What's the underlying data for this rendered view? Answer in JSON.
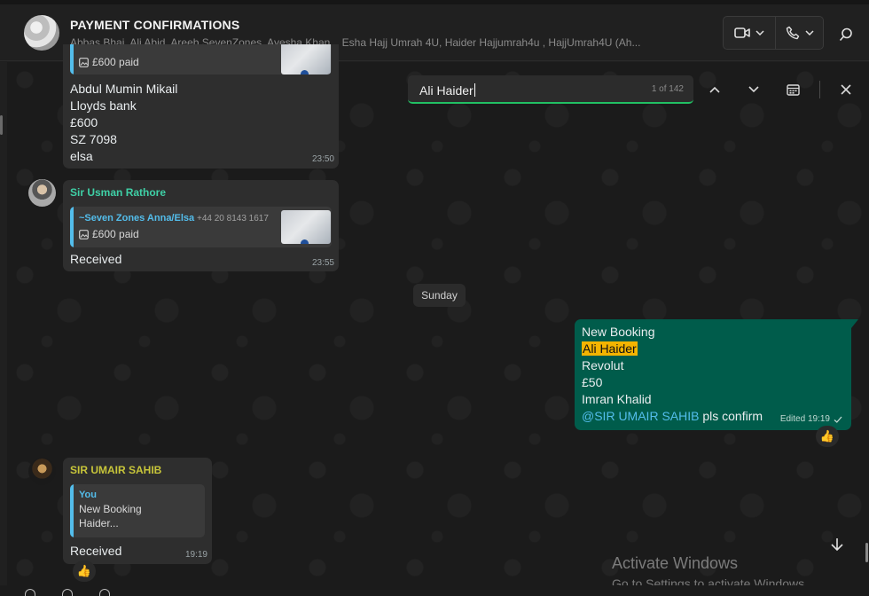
{
  "header": {
    "title": "PAYMENT CONFIRMATIONS",
    "members": "Abbas Bhai, Ali Abid, Areeb SevenZones, Ayesha Khan.., Esha Hajj Umrah 4U, Haider Hajjumrah4u , HajjUmrah4U (Ah..."
  },
  "search": {
    "value": "Ali Haider",
    "count": "1 of 142"
  },
  "messages": {
    "first": {
      "quote_text": "£600 paid",
      "lines": [
        "Abdul Mumin Mikail",
        "Lloyds bank",
        "£600",
        "SZ 7098",
        "elsa"
      ],
      "time": "23:50"
    },
    "usman": {
      "sender": "Sir Usman Rathore",
      "quote_name": "~Seven Zones Anna/Elsa",
      "quote_phone": "+44 20 8143 1617",
      "quote_text": "£600 paid",
      "text": "Received",
      "time": "23:55"
    },
    "day_divider": "Sunday",
    "outgoing": {
      "line1": "New Booking",
      "highlight": "Ali Haider",
      "line3": "Revolut",
      "line4": "£50",
      "line5": "Imran Khalid",
      "mention": "@SIR UMAIR SAHIB",
      "suffix": " pls confirm",
      "status": "Edited 19:19",
      "reaction": "👍"
    },
    "umair": {
      "sender": "SIR UMAIR SAHIB",
      "quote_name": "You",
      "quote_line1": "New Booking",
      "quote_line2": "Haider...",
      "text": "Received",
      "time": "19:19",
      "reaction": "👍"
    }
  },
  "watermark": {
    "title": "Activate Windows",
    "subtitle": "Go to Settings to activate Windows."
  },
  "colors": {
    "accent_green": "#21c063",
    "outgoing_bubble": "#005c4b",
    "incoming_bubble": "#2e2e2e",
    "usman_name": "#3fd0a6",
    "umair_name": "#c7c53a",
    "highlight": "#f4b400"
  }
}
